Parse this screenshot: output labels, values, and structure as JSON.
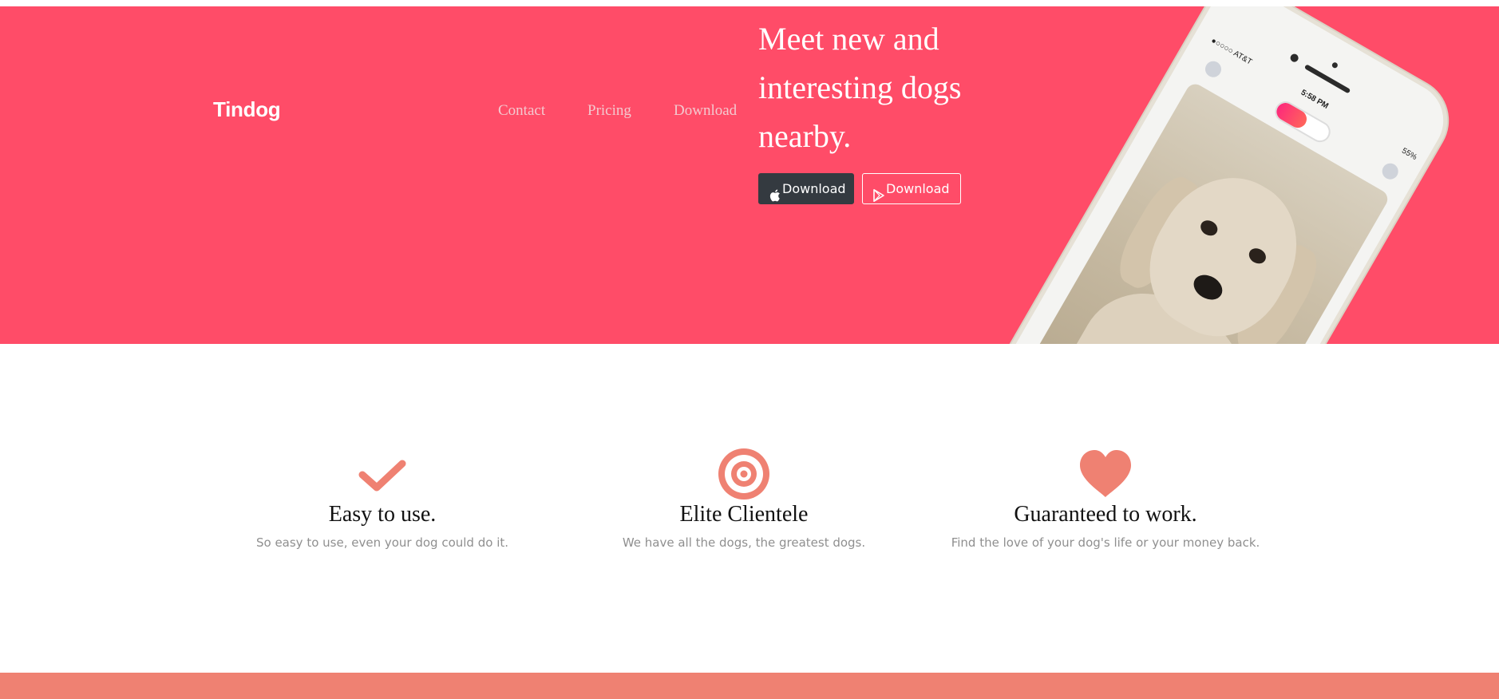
{
  "brand": {
    "name": "Tindog"
  },
  "nav": {
    "items": [
      {
        "label": "Contact"
      },
      {
        "label": "Pricing"
      },
      {
        "label": "Download"
      }
    ]
  },
  "hero": {
    "headline": "Meet new and interesting dogs nearby.",
    "buttons": [
      {
        "label": "Download",
        "icon": "apple-icon",
        "style": "dark"
      },
      {
        "label": "Download",
        "icon": "play-store-icon",
        "style": "outline"
      }
    ],
    "phone": {
      "carrier": "●○○○○ AT&T",
      "time": "5:58 PM",
      "battery": "55%"
    }
  },
  "features": [
    {
      "icon": "checkmark-icon",
      "title": "Easy to use.",
      "description": "So easy to use, even your dog could do it."
    },
    {
      "icon": "target-icon",
      "title": "Elite Clientele",
      "description": "We have all the dogs, the greatest dogs."
    },
    {
      "icon": "heart-icon",
      "title": "Guaranteed to work.",
      "description": "Find the love of your dog's life or your money back."
    }
  ],
  "colors": {
    "hero_bg": "#ff4c68",
    "accent": "#ef8172",
    "dark_button": "#343a40"
  }
}
